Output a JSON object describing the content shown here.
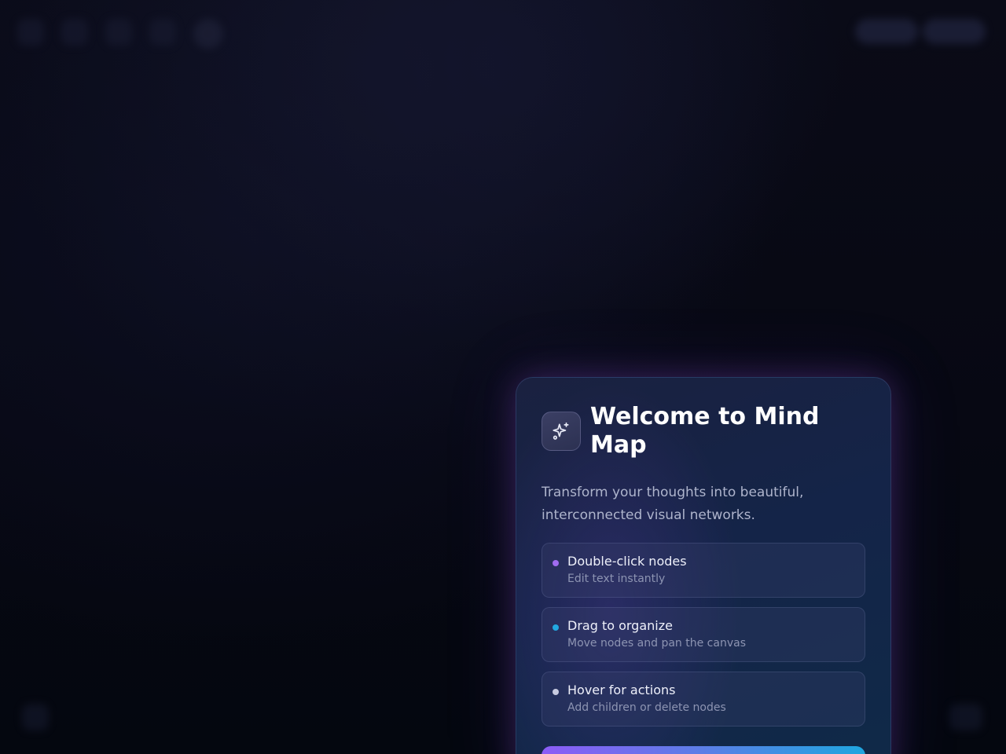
{
  "app": {
    "title": "Welcome to Mind Map",
    "subtitle": "Transform your thoughts into beautiful, interconnected visual networks."
  },
  "welcome": {
    "icon": "sparkles-icon",
    "features": [
      {
        "title": "Double-click nodes",
        "description": "Edit text instantly",
        "dot_color": "#a06cf0"
      },
      {
        "title": "Drag to organize",
        "description": "Move nodes and pan the canvas",
        "dot_color": "#22a8e0"
      },
      {
        "title": "Hover for actions",
        "description": "Add children or delete nodes",
        "dot_color": "#c7cbe0"
      }
    ]
  },
  "colors": {
    "accent_start": "#8b5cf6",
    "accent_end": "#1fa6df",
    "background": "#06070f"
  }
}
